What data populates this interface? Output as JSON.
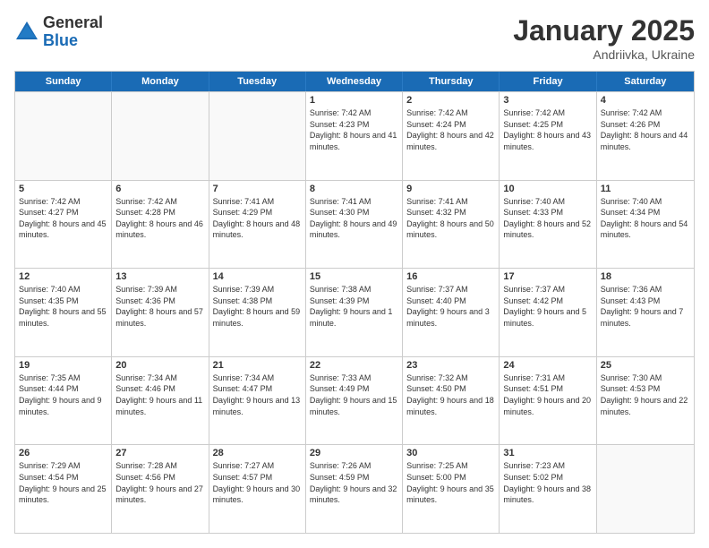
{
  "logo": {
    "general": "General",
    "blue": "Blue"
  },
  "title": "January 2025",
  "location": "Andriivka, Ukraine",
  "weekdays": [
    "Sunday",
    "Monday",
    "Tuesday",
    "Wednesday",
    "Thursday",
    "Friday",
    "Saturday"
  ],
  "rows": [
    [
      {
        "day": "",
        "text": ""
      },
      {
        "day": "",
        "text": ""
      },
      {
        "day": "",
        "text": ""
      },
      {
        "day": "1",
        "text": "Sunrise: 7:42 AM\nSunset: 4:23 PM\nDaylight: 8 hours and 41 minutes."
      },
      {
        "day": "2",
        "text": "Sunrise: 7:42 AM\nSunset: 4:24 PM\nDaylight: 8 hours and 42 minutes."
      },
      {
        "day": "3",
        "text": "Sunrise: 7:42 AM\nSunset: 4:25 PM\nDaylight: 8 hours and 43 minutes."
      },
      {
        "day": "4",
        "text": "Sunrise: 7:42 AM\nSunset: 4:26 PM\nDaylight: 8 hours and 44 minutes."
      }
    ],
    [
      {
        "day": "5",
        "text": "Sunrise: 7:42 AM\nSunset: 4:27 PM\nDaylight: 8 hours and 45 minutes."
      },
      {
        "day": "6",
        "text": "Sunrise: 7:42 AM\nSunset: 4:28 PM\nDaylight: 8 hours and 46 minutes."
      },
      {
        "day": "7",
        "text": "Sunrise: 7:41 AM\nSunset: 4:29 PM\nDaylight: 8 hours and 48 minutes."
      },
      {
        "day": "8",
        "text": "Sunrise: 7:41 AM\nSunset: 4:30 PM\nDaylight: 8 hours and 49 minutes."
      },
      {
        "day": "9",
        "text": "Sunrise: 7:41 AM\nSunset: 4:32 PM\nDaylight: 8 hours and 50 minutes."
      },
      {
        "day": "10",
        "text": "Sunrise: 7:40 AM\nSunset: 4:33 PM\nDaylight: 8 hours and 52 minutes."
      },
      {
        "day": "11",
        "text": "Sunrise: 7:40 AM\nSunset: 4:34 PM\nDaylight: 8 hours and 54 minutes."
      }
    ],
    [
      {
        "day": "12",
        "text": "Sunrise: 7:40 AM\nSunset: 4:35 PM\nDaylight: 8 hours and 55 minutes."
      },
      {
        "day": "13",
        "text": "Sunrise: 7:39 AM\nSunset: 4:36 PM\nDaylight: 8 hours and 57 minutes."
      },
      {
        "day": "14",
        "text": "Sunrise: 7:39 AM\nSunset: 4:38 PM\nDaylight: 8 hours and 59 minutes."
      },
      {
        "day": "15",
        "text": "Sunrise: 7:38 AM\nSunset: 4:39 PM\nDaylight: 9 hours and 1 minute."
      },
      {
        "day": "16",
        "text": "Sunrise: 7:37 AM\nSunset: 4:40 PM\nDaylight: 9 hours and 3 minutes."
      },
      {
        "day": "17",
        "text": "Sunrise: 7:37 AM\nSunset: 4:42 PM\nDaylight: 9 hours and 5 minutes."
      },
      {
        "day": "18",
        "text": "Sunrise: 7:36 AM\nSunset: 4:43 PM\nDaylight: 9 hours and 7 minutes."
      }
    ],
    [
      {
        "day": "19",
        "text": "Sunrise: 7:35 AM\nSunset: 4:44 PM\nDaylight: 9 hours and 9 minutes."
      },
      {
        "day": "20",
        "text": "Sunrise: 7:34 AM\nSunset: 4:46 PM\nDaylight: 9 hours and 11 minutes."
      },
      {
        "day": "21",
        "text": "Sunrise: 7:34 AM\nSunset: 4:47 PM\nDaylight: 9 hours and 13 minutes."
      },
      {
        "day": "22",
        "text": "Sunrise: 7:33 AM\nSunset: 4:49 PM\nDaylight: 9 hours and 15 minutes."
      },
      {
        "day": "23",
        "text": "Sunrise: 7:32 AM\nSunset: 4:50 PM\nDaylight: 9 hours and 18 minutes."
      },
      {
        "day": "24",
        "text": "Sunrise: 7:31 AM\nSunset: 4:51 PM\nDaylight: 9 hours and 20 minutes."
      },
      {
        "day": "25",
        "text": "Sunrise: 7:30 AM\nSunset: 4:53 PM\nDaylight: 9 hours and 22 minutes."
      }
    ],
    [
      {
        "day": "26",
        "text": "Sunrise: 7:29 AM\nSunset: 4:54 PM\nDaylight: 9 hours and 25 minutes."
      },
      {
        "day": "27",
        "text": "Sunrise: 7:28 AM\nSunset: 4:56 PM\nDaylight: 9 hours and 27 minutes."
      },
      {
        "day": "28",
        "text": "Sunrise: 7:27 AM\nSunset: 4:57 PM\nDaylight: 9 hours and 30 minutes."
      },
      {
        "day": "29",
        "text": "Sunrise: 7:26 AM\nSunset: 4:59 PM\nDaylight: 9 hours and 32 minutes."
      },
      {
        "day": "30",
        "text": "Sunrise: 7:25 AM\nSunset: 5:00 PM\nDaylight: 9 hours and 35 minutes."
      },
      {
        "day": "31",
        "text": "Sunrise: 7:23 AM\nSunset: 5:02 PM\nDaylight: 9 hours and 38 minutes."
      },
      {
        "day": "",
        "text": ""
      }
    ]
  ]
}
